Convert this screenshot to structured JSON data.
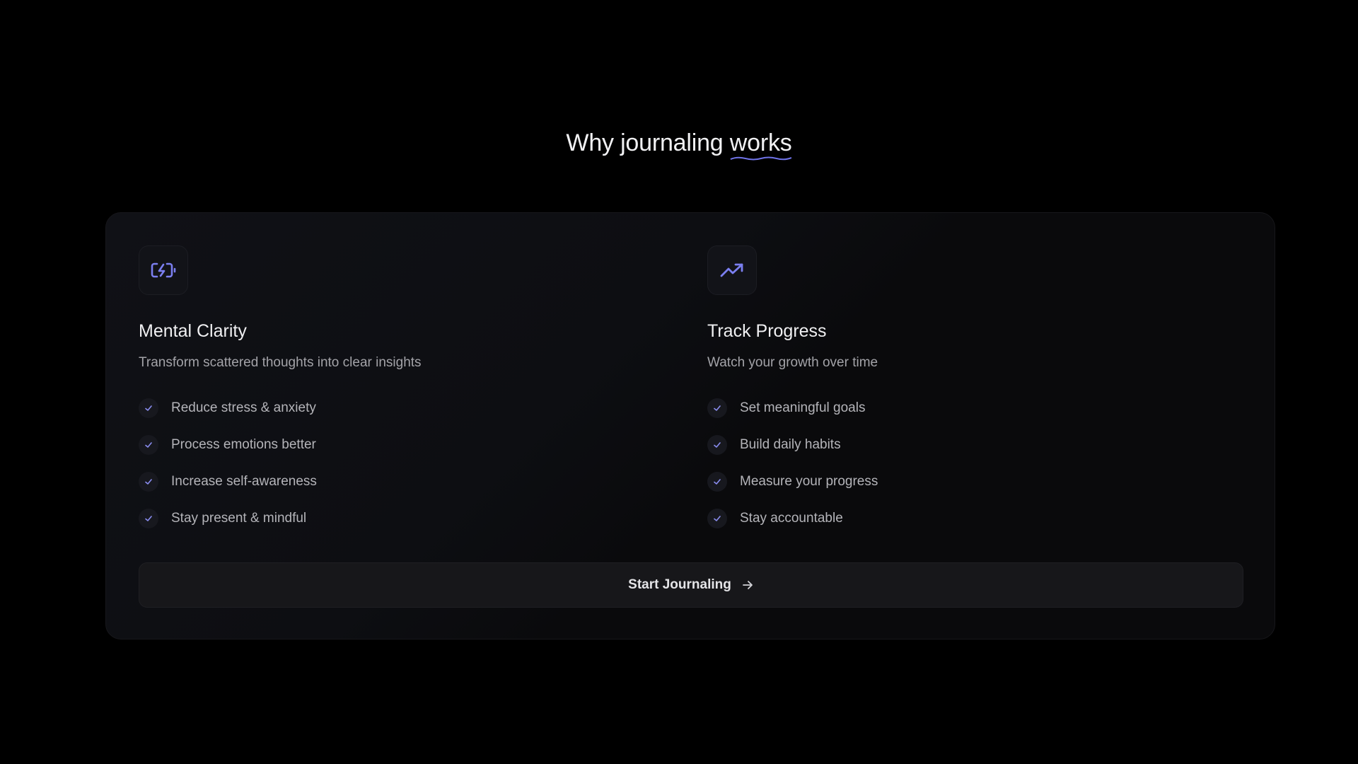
{
  "heading": {
    "prefix": "Why journaling ",
    "accent": "works"
  },
  "colors": {
    "accent": "#7b7ff0",
    "background": "#000000",
    "card": "#0d0e12"
  },
  "features": [
    {
      "icon": "battery-charging-icon",
      "title": "Mental Clarity",
      "subtitle": "Transform scattered thoughts into clear insights",
      "items": [
        "Reduce stress & anxiety",
        "Process emotions better",
        "Increase self-awareness",
        "Stay present & mindful"
      ]
    },
    {
      "icon": "trending-up-icon",
      "title": "Track Progress",
      "subtitle": "Watch your growth over time",
      "items": [
        "Set meaningful goals",
        "Build daily habits",
        "Measure your progress",
        "Stay accountable"
      ]
    }
  ],
  "cta": {
    "label": "Start Journaling",
    "icon": "arrow-right-icon"
  }
}
